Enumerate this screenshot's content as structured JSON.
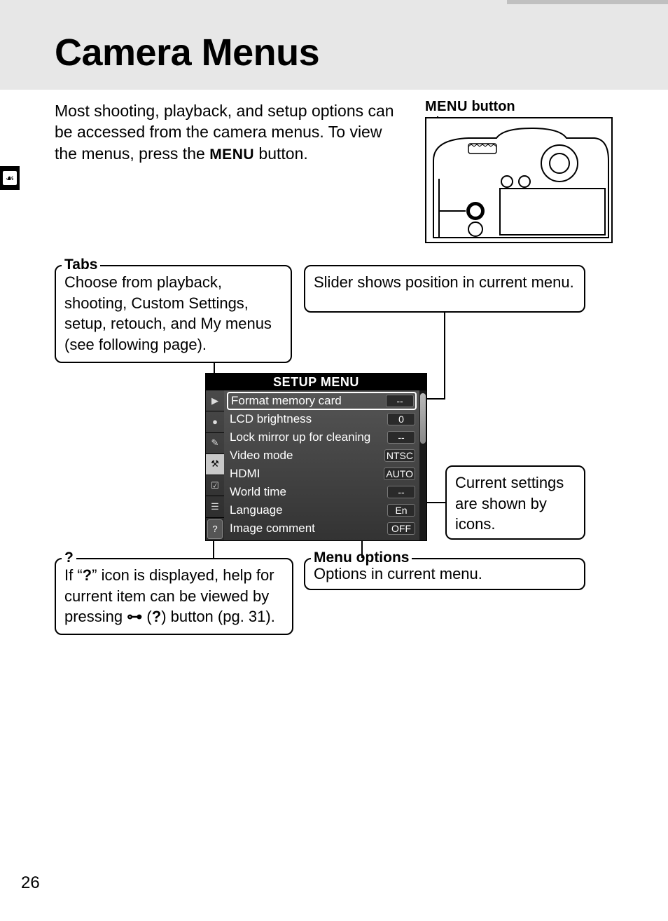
{
  "page": {
    "title": "Camera Menus",
    "page_number": "26",
    "intro_pre": "Most shooting, playback, and setup options can be accessed from the camera menus.  To view the menus, press the ",
    "intro_menu": "MENU",
    "intro_post": " button."
  },
  "menu_button_caption": {
    "menu": "MENU",
    "label": " button"
  },
  "annotations": {
    "tabs": {
      "label": "Tabs",
      "text": "Choose from playback, shooting, Custom Settings, setup, retouch, and My menus (see following page)."
    },
    "slider": {
      "text": "Slider shows position in current menu."
    },
    "settings": {
      "text": "Current settings are shown by icons."
    },
    "help": {
      "label": "?",
      "text_pre": "If “",
      "text_icon": "?",
      "text_mid": "” icon is displayed, help for current item can be viewed by pressing ",
      "key_icon": "⚷",
      "text_paren": " (",
      "text_q": "?",
      "text_post": ") button (pg. 31)."
    },
    "options": {
      "label": "Menu options",
      "text": "Options in current menu."
    }
  },
  "lcd": {
    "title": "SETUP MENU",
    "tabs": [
      "▶",
      "●",
      "✎",
      "⚒",
      "☑",
      "☰",
      "?"
    ],
    "selected_tab_index": 3,
    "items": [
      {
        "name": "Format memory card",
        "value": "--"
      },
      {
        "name": "LCD brightness",
        "value": "0"
      },
      {
        "name": "Lock mirror up for cleaning",
        "value": "--"
      },
      {
        "name": "Video mode",
        "value": "NTSC"
      },
      {
        "name": "HDMI",
        "value": "AUTO"
      },
      {
        "name": "World time",
        "value": "--"
      },
      {
        "name": "Language",
        "value": "En"
      },
      {
        "name": "Image comment",
        "value": "OFF"
      }
    ],
    "selected_item_index": 0
  }
}
